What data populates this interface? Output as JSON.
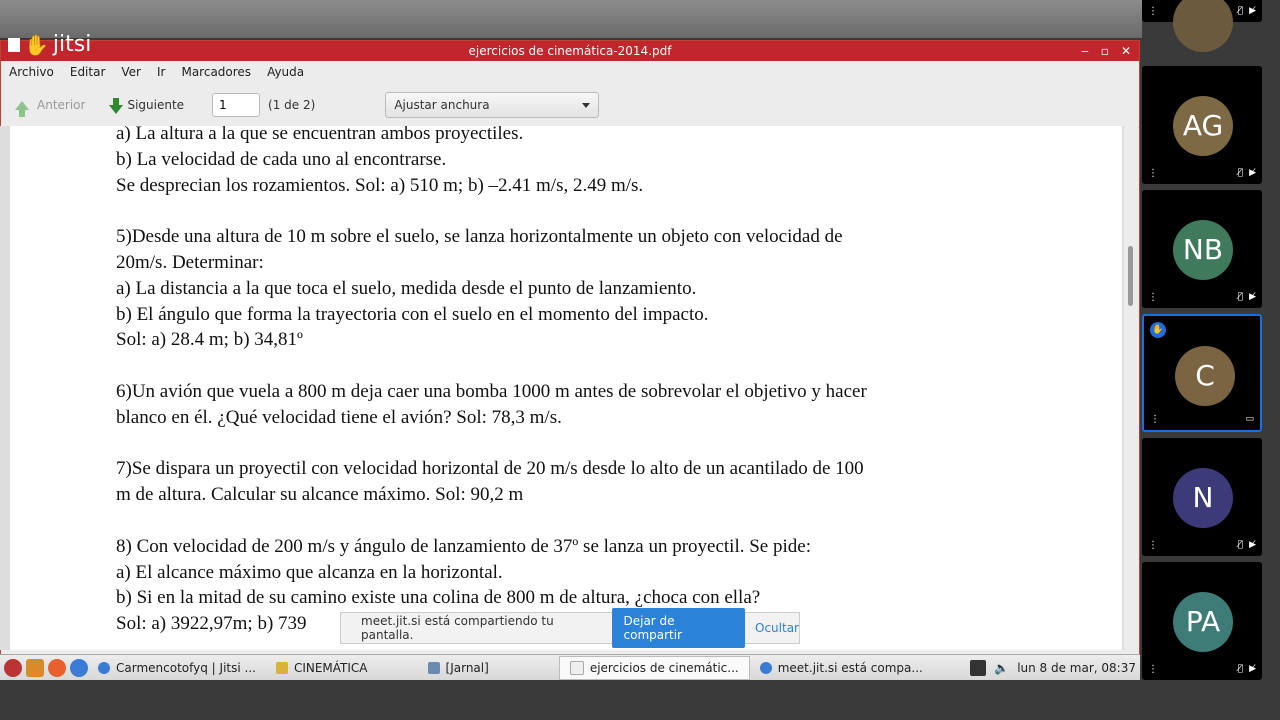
{
  "app": {
    "logo_text": "jitsi"
  },
  "window": {
    "title": "ejercicios de cinemática-2014.pdf",
    "controls": {
      "minimize": "‒",
      "maximize": "▫",
      "close": "✕"
    }
  },
  "menu": {
    "items": [
      "Archivo",
      "Editar",
      "Ver",
      "Ir",
      "Marcadores",
      "Ayuda"
    ]
  },
  "toolbar": {
    "prev_label": "Anterior",
    "next_label": "Siguiente",
    "page_value": "1",
    "page_count": "(1 de 2)",
    "zoom_value": "Ajustar anchura"
  },
  "document": {
    "lines": [
      "a) La altura a la que se encuentran ambos proyectiles.",
      "b) La velocidad de cada uno al encontrarse.",
      "Se desprecian los rozamientos. Sol: a) 510 m; b) –2.41 m/s, 2.49 m/s.",
      "",
      "5)Desde una altura de 10 m sobre el suelo, se lanza horizontalmente un objeto con velocidad de",
      "20m/s. Determinar:",
      "a) La distancia a la que toca el suelo, medida desde el punto de lanzamiento.",
      "b) El ángulo que forma la trayectoria con el suelo en el momento del impacto.",
      "Sol: a) 28.4 m; b) 34,81º",
      "",
      "6)Un avión que vuela a 800 m deja caer una bomba 1000 m antes de sobrevolar el objetivo y hacer",
      "blanco en él. ¿Qué velocidad tiene el avión? Sol: 78,3 m/s.",
      "",
      "7)Se dispara un proyectil con velocidad horizontal de 20 m/s desde lo alto de un acantilado de 100",
      "m de altura. Calcular su alcance máximo. Sol: 90,2 m",
      "",
      "8) Con velocidad de 200 m/s y ángulo de lanzamiento de 37º se lanza un proyectil. Se pide:",
      "a) El alcance máximo que alcanza en la horizontal.",
      "b) Si en la mitad de su camino existe una colina de 800 m de altura, ¿choca con ella?",
      "Sol: a) 3922,97m; b) 739"
    ]
  },
  "share_bar": {
    "message": "meet.jit.si está compartiendo tu pantalla.",
    "stop_label": "Dejar de compartir",
    "hide_label": "Ocultar"
  },
  "taskbar": {
    "items": [
      "Carmencotofyq | Jitsi ...",
      "CINEMÁTICA",
      "[Jarnal]",
      "ejercicios de cinemátic...",
      "meet.jit.si está compa..."
    ],
    "clock": "lun  8 de mar, 08:37"
  },
  "participants": [
    {
      "initials": "",
      "color": "#6b5a3e"
    },
    {
      "initials": "AG",
      "color": "#7d6a45"
    },
    {
      "initials": "NB",
      "color": "#3f7a5d"
    },
    {
      "initials": "C",
      "color": "#7a6442"
    },
    {
      "initials": "N",
      "color": "#3d3a7a"
    },
    {
      "initials": "PA",
      "color": "#3e7c78"
    }
  ],
  "colors": {
    "titlebar": "#c0262c",
    "accent": "#2a82d9",
    "speaker_border": "#1d6fd8"
  }
}
